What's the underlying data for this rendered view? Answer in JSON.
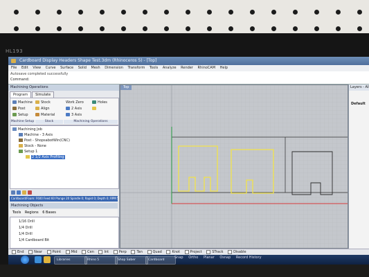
{
  "monitor": {
    "label": "HL193"
  },
  "window": {
    "title": "Cardboard Display Headers Shape Test.3dm (Rhinoceros 5) - [Top]",
    "menu": [
      "File",
      "Edit",
      "View",
      "Curve",
      "Surface",
      "Solid",
      "Mesh",
      "Dimension",
      "Transform",
      "Tools",
      "Analyze",
      "Render",
      "RhinoCAM",
      "Help"
    ]
  },
  "command": {
    "history": "Autosave completed successfully",
    "prompt": "Command:"
  },
  "machining_ops": {
    "header": "Machining Operations",
    "tabs": [
      "Program",
      "Simulate"
    ],
    "ribbon": {
      "machine": "Machine",
      "post": "Post",
      "setup": "Setup",
      "stock": "Stock",
      "align": "Align",
      "material": "Material",
      "work_zero": "Work Zero",
      "axis2": "2 Axis",
      "axis3": "3 Axis",
      "holes": "Holes",
      "groups": [
        "Machine Setup",
        "Stock",
        "Machining Operations"
      ]
    },
    "tree": {
      "root": "Machining Job",
      "machine": "Machine - 3 Axis",
      "post": "Post - ShopsabotWin(CNC)",
      "stock": "Stock - None",
      "setup": "Setup 1",
      "operation": "2 1/2 Axis Profiling"
    },
    "status_strip": "Cardboard/Foam: F600 Feed 60 Plunge 20 Spindle 0; Rapid 0; Depth 0; RPM 5000 | 1 / 1.8"
  },
  "machining_objects": {
    "header": "Machining Objects",
    "tools_label": "Tools",
    "regions_label": "Regions",
    "bases_label": "6 Bases",
    "tools": [
      "1/16 Drill",
      "1/4 Drill",
      "1/4 Drill",
      "1/4 Cardboard Bit"
    ]
  },
  "viewport": {
    "label": "Top"
  },
  "layers": {
    "header": "Layers - All",
    "item": "Default"
  },
  "osnap": [
    "End",
    "Near",
    "Point",
    "Mid",
    "Cen",
    "Int",
    "Perp",
    "Tan",
    "Quad",
    "Knot",
    "Project",
    "STrack",
    "Disable"
  ],
  "taskbar": {
    "buttons": [
      "Libraries",
      "Rhino 5",
      "Shop Saber",
      "Cardboard"
    ]
  },
  "bottom_tabs": [
    "Snap",
    "Ortho",
    "Planar",
    "Osnap",
    "Record History"
  ],
  "colors": {
    "profile_yellow": "#f2e34a",
    "red_axis": "#d63a3a",
    "green_axis": "#2f9a49",
    "grid": "#b4b8bd"
  }
}
